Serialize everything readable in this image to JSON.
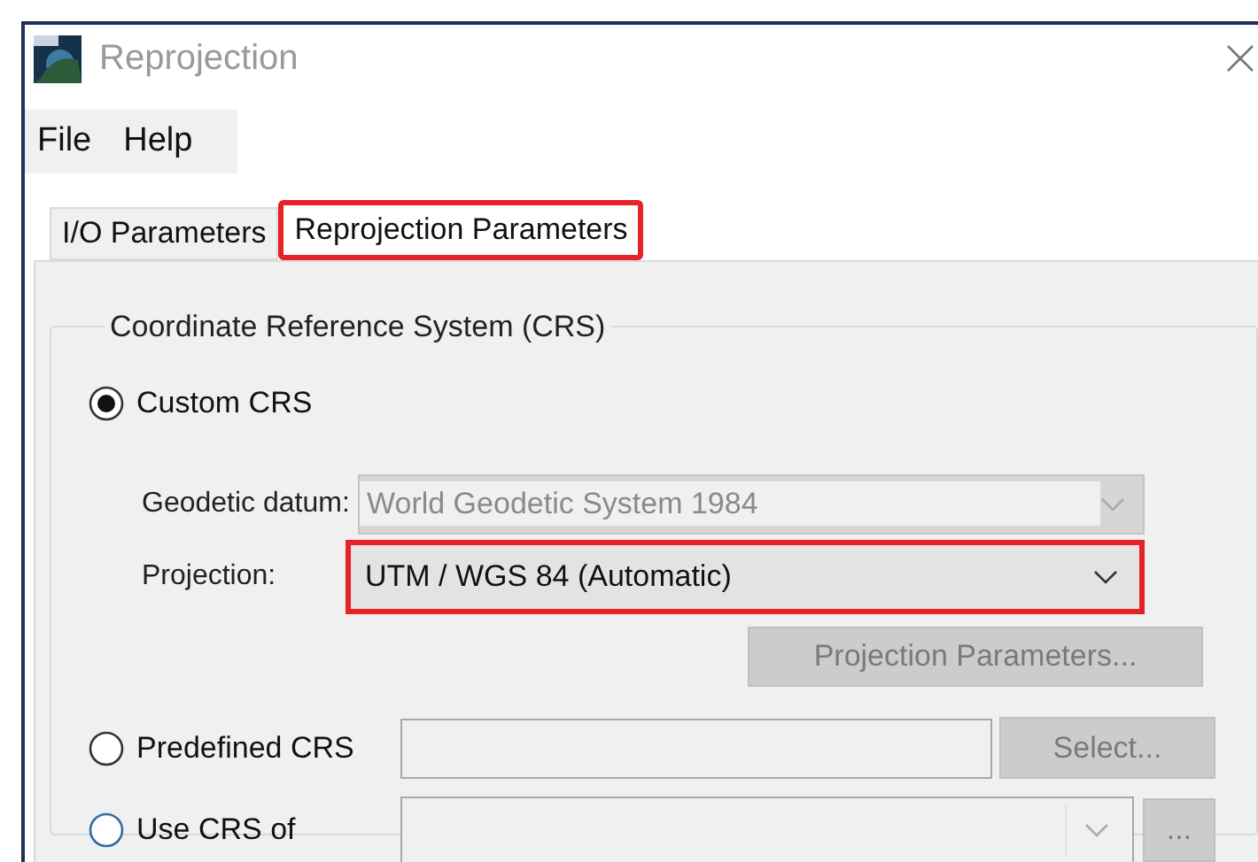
{
  "window": {
    "title": "Reprojection"
  },
  "menu": [
    {
      "label": "File"
    },
    {
      "label": "Help"
    }
  ],
  "tabs": [
    {
      "label": "I/O Parameters",
      "selected": false,
      "highlighted": false
    },
    {
      "label": "Reprojection Parameters",
      "selected": true,
      "highlighted": true
    }
  ],
  "crs_group": {
    "title": "Coordinate Reference System (CRS)",
    "options": [
      {
        "label": "Custom CRS",
        "selected": true
      },
      {
        "label": "Predefined CRS",
        "selected": false
      },
      {
        "label": "Use CRS of",
        "selected": false
      }
    ],
    "geodetic_datum": {
      "label": "Geodetic datum:",
      "value": "World Geodetic System 1984",
      "disabled": true
    },
    "projection": {
      "label": "Projection:",
      "value": "UTM / WGS 84 (Automatic)",
      "disabled": false,
      "highlighted": true
    },
    "projection_parameters_button": {
      "label": "Projection Parameters...",
      "disabled": true
    },
    "select_button": {
      "label": "Select...",
      "disabled": true
    },
    "browse_button": {
      "label": "...",
      "disabled": true
    }
  }
}
